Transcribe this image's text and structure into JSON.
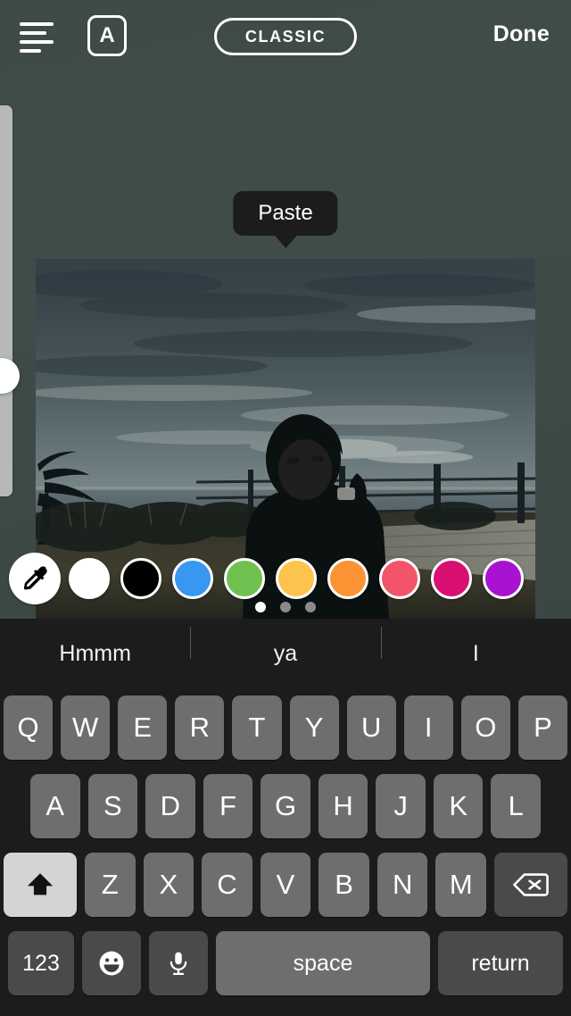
{
  "app": {
    "name": "story-text-editor",
    "background_color": "#3e4a48"
  },
  "topbar": {
    "align_icon": "text-align-icon",
    "letter_button_label": "A",
    "style_pill_label": "CLASSIC",
    "done_label": "Done"
  },
  "slider": {
    "name": "text-size-slider",
    "value_position": "middle"
  },
  "tooltip": {
    "label": "Paste"
  },
  "photo": {
    "name": "story-photo",
    "description": "person sitting outdoors at dusk with sky, palm tree and fence"
  },
  "color_picker": {
    "eyedropper_icon": "eyedropper-icon",
    "swatches": [
      {
        "name": "white",
        "hex": "#ffffff"
      },
      {
        "name": "black",
        "hex": "#000000"
      },
      {
        "name": "blue",
        "hex": "#3897f0"
      },
      {
        "name": "green",
        "hex": "#70c050"
      },
      {
        "name": "yellow",
        "hex": "#fcc44c"
      },
      {
        "name": "orange",
        "hex": "#fb9334"
      },
      {
        "name": "red",
        "hex": "#f4546a"
      },
      {
        "name": "magenta",
        "hex": "#d90f72"
      },
      {
        "name": "purple",
        "hex": "#a713d0"
      }
    ],
    "page_dots": {
      "count": 3,
      "active_index": 0
    }
  },
  "keyboard": {
    "suggestions": [
      "Hmmm",
      "ya",
      "I"
    ],
    "row1": [
      "Q",
      "W",
      "E",
      "R",
      "T",
      "Y",
      "U",
      "I",
      "O",
      "P"
    ],
    "row2": [
      "A",
      "S",
      "D",
      "F",
      "G",
      "H",
      "J",
      "K",
      "L"
    ],
    "row3": [
      "Z",
      "X",
      "C",
      "V",
      "B",
      "N",
      "M"
    ],
    "shift_icon": "shift-arrow-icon",
    "shift_active": true,
    "backspace_icon": "backspace-icon",
    "numbers_label": "123",
    "emoji_icon": "emoji-smiley-icon",
    "mic_icon": "microphone-icon",
    "space_label": "space",
    "return_label": "return"
  }
}
